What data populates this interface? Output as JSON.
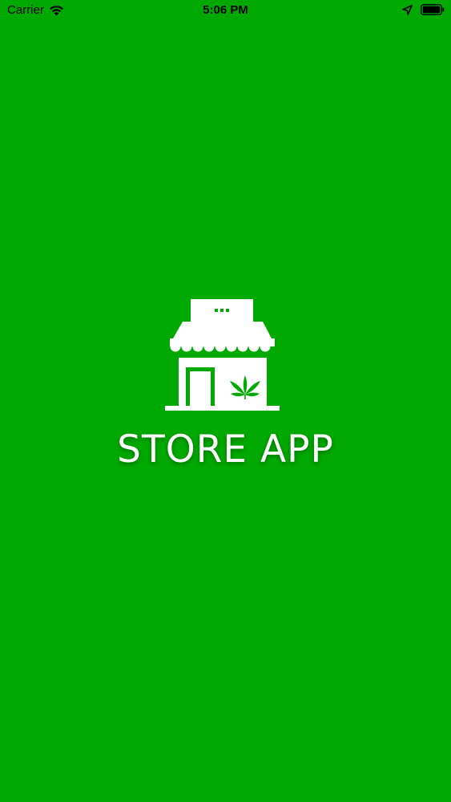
{
  "status_bar": {
    "carrier": "Carrier",
    "time": "5:06 PM",
    "icons": [
      "wifi-icon",
      "location-arrow-icon",
      "battery-icon"
    ]
  },
  "splash": {
    "logo_icon": "store-front-icon",
    "title": "STORE APP"
  },
  "colors": {
    "background": "#00a900",
    "title": "#ffffff",
    "status_text": "#000000"
  }
}
